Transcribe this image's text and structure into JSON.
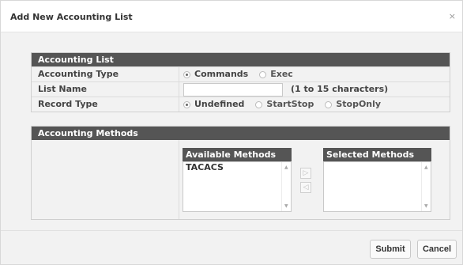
{
  "dialog": {
    "title": "Add New Accounting List",
    "close_glyph": "×"
  },
  "accounting_list": {
    "header": "Accounting List",
    "accounting_type": {
      "label": "Accounting Type",
      "options": [
        "Commands",
        "Exec"
      ],
      "selected": "Commands"
    },
    "list_name": {
      "label": "List Name",
      "value": "",
      "hint": "(1 to 15 characters)"
    },
    "record_type": {
      "label": "Record Type",
      "options": [
        "Undefined",
        "StartStop",
        "StopOnly"
      ],
      "selected": "Undefined"
    }
  },
  "accounting_methods": {
    "header": "Accounting Methods",
    "available": {
      "header": "Available Methods",
      "items": [
        "TACACS"
      ]
    },
    "selected": {
      "header": "Selected Methods",
      "items": []
    },
    "move_right_glyph": "▷",
    "move_left_glyph": "◁",
    "scroll_up_glyph": "▲",
    "scroll_down_glyph": "▼"
  },
  "footer": {
    "submit_label": "Submit",
    "cancel_label": "Cancel"
  }
}
